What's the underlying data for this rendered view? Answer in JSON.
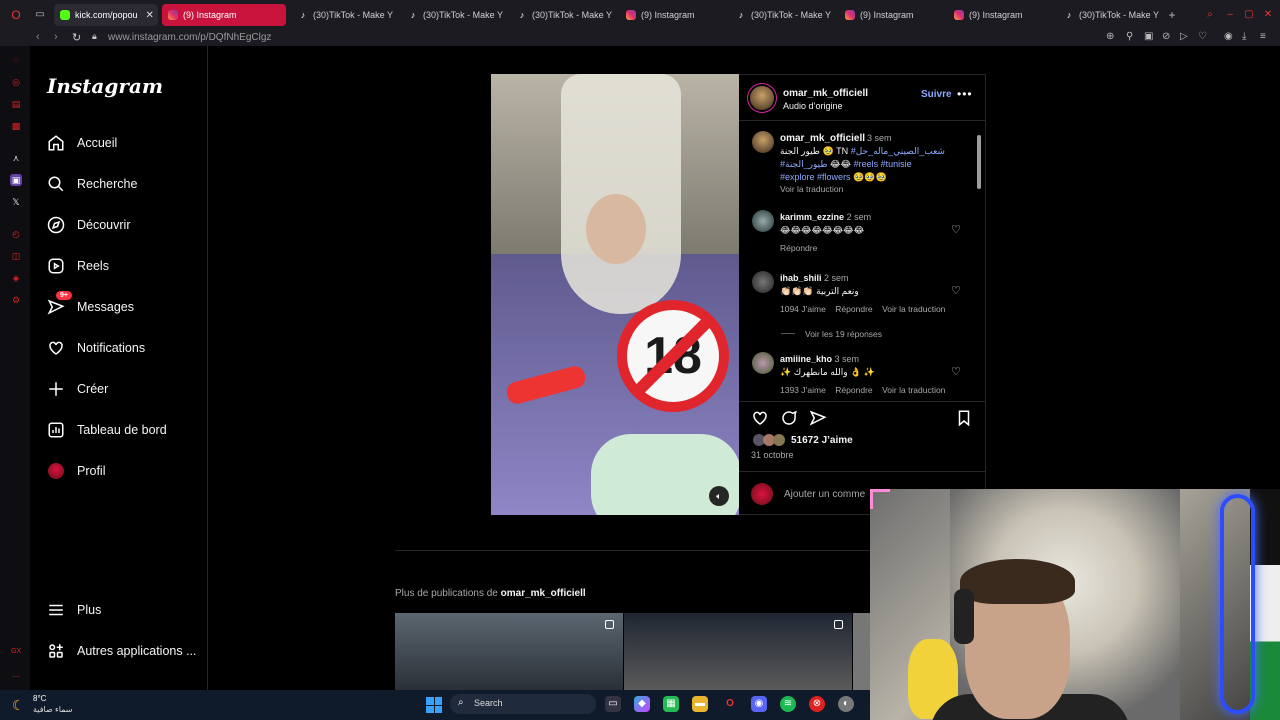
{
  "browser": {
    "tabs": [
      {
        "label": "kick.com/popou",
        "icon": "kick-icon",
        "active": false
      },
      {
        "label": "(9) Instagram",
        "icon": "instagram-icon",
        "active": true
      },
      {
        "label": "(30)TikTok - Make Y",
        "icon": "tiktok-icon",
        "active": false
      },
      {
        "label": "(30)TikTok - Make Y",
        "icon": "tiktok-icon",
        "active": false
      },
      {
        "label": "(30)TikTok - Make Y",
        "icon": "tiktok-icon",
        "active": false
      },
      {
        "label": "(9) Instagram",
        "icon": "instagram-icon",
        "active": false
      },
      {
        "label": "(30)TikTok - Make Y",
        "icon": "tiktok-icon",
        "active": false
      },
      {
        "label": "(9) Instagram",
        "icon": "instagram-icon",
        "active": false
      },
      {
        "label": "(9) Instagram",
        "icon": "instagram-icon",
        "active": false
      },
      {
        "label": "(30)TikTok - Make Y",
        "icon": "tiktok-icon",
        "active": false
      }
    ],
    "url": "www.instagram.com/p/DQfNhEgClgz",
    "accent": "#c8143c"
  },
  "sidebar": {
    "logo": "Instagram",
    "items": [
      {
        "label": "Accueil",
        "icon": "home-icon"
      },
      {
        "label": "Recherche",
        "icon": "search-icon"
      },
      {
        "label": "Découvrir",
        "icon": "compass-icon"
      },
      {
        "label": "Reels",
        "icon": "reels-icon"
      },
      {
        "label": "Messages",
        "icon": "messenger-icon",
        "badge": "9+"
      },
      {
        "label": "Notifications",
        "icon": "heart-icon"
      },
      {
        "label": "Créer",
        "icon": "plus-icon"
      },
      {
        "label": "Tableau de bord",
        "icon": "dashboard-icon"
      },
      {
        "label": "Profil",
        "icon": "profile-avatar"
      }
    ],
    "bottom": [
      {
        "label": "Plus",
        "icon": "menu-icon"
      },
      {
        "label": "Autres applications ...",
        "icon": "apps-icon"
      }
    ]
  },
  "post": {
    "media_badge": "18",
    "author": "omar_mk_officiell",
    "audio": "Audio d’origine",
    "follow_label": "Suivre",
    "caption": {
      "user": "omar_mk_officiell",
      "age": "3 sem",
      "line1": "طيور الجنة 🥹 TN",
      "line1_tag": "#شعب_الصيني_ماله_حل",
      "line2_tag": "#طيور_الجنة",
      "line2_rest": "😂😂",
      "tag_reels": "#reels",
      "tag_tunisie": "#tunisie",
      "tag_explore": "#explore",
      "tag_flowers": "#flowers",
      "line3_emojis": "🥹🥹🥹",
      "translate": "Voir la traduction"
    },
    "comments": [
      {
        "user": "karimm_ezzine",
        "age": "2 sem",
        "text": "😂😂😂😂😂😂😂😂",
        "likes": "",
        "reply": "Répondre",
        "translate": ""
      },
      {
        "user": "ihab_shili",
        "age": "2 sem",
        "text": "👏🏻👏🏻👏🏻 ونعم التربية",
        "likes": "1094 J’aime",
        "reply": "Répondre",
        "translate": "Voir la traduction"
      },
      {
        "user": "amiiine_kho",
        "age": "3 sem",
        "text": "✨ والله مانطهرك 👌 ✨",
        "likes": "1393 J’aime",
        "reply": "Répondre",
        "translate": "Voir la traduction"
      }
    ],
    "view_replies": "Voir les 19 réponses",
    "likes_total": "51672 J’aime",
    "date": "31 octobre",
    "comment_placeholder": "Ajouter un comme"
  },
  "more_posts": {
    "prefix": "Plus de publications de",
    "user": "omar_mk_officiell"
  },
  "taskbar": {
    "temp": "8°C",
    "weather": "سماء صافية",
    "search_label": "Search"
  }
}
